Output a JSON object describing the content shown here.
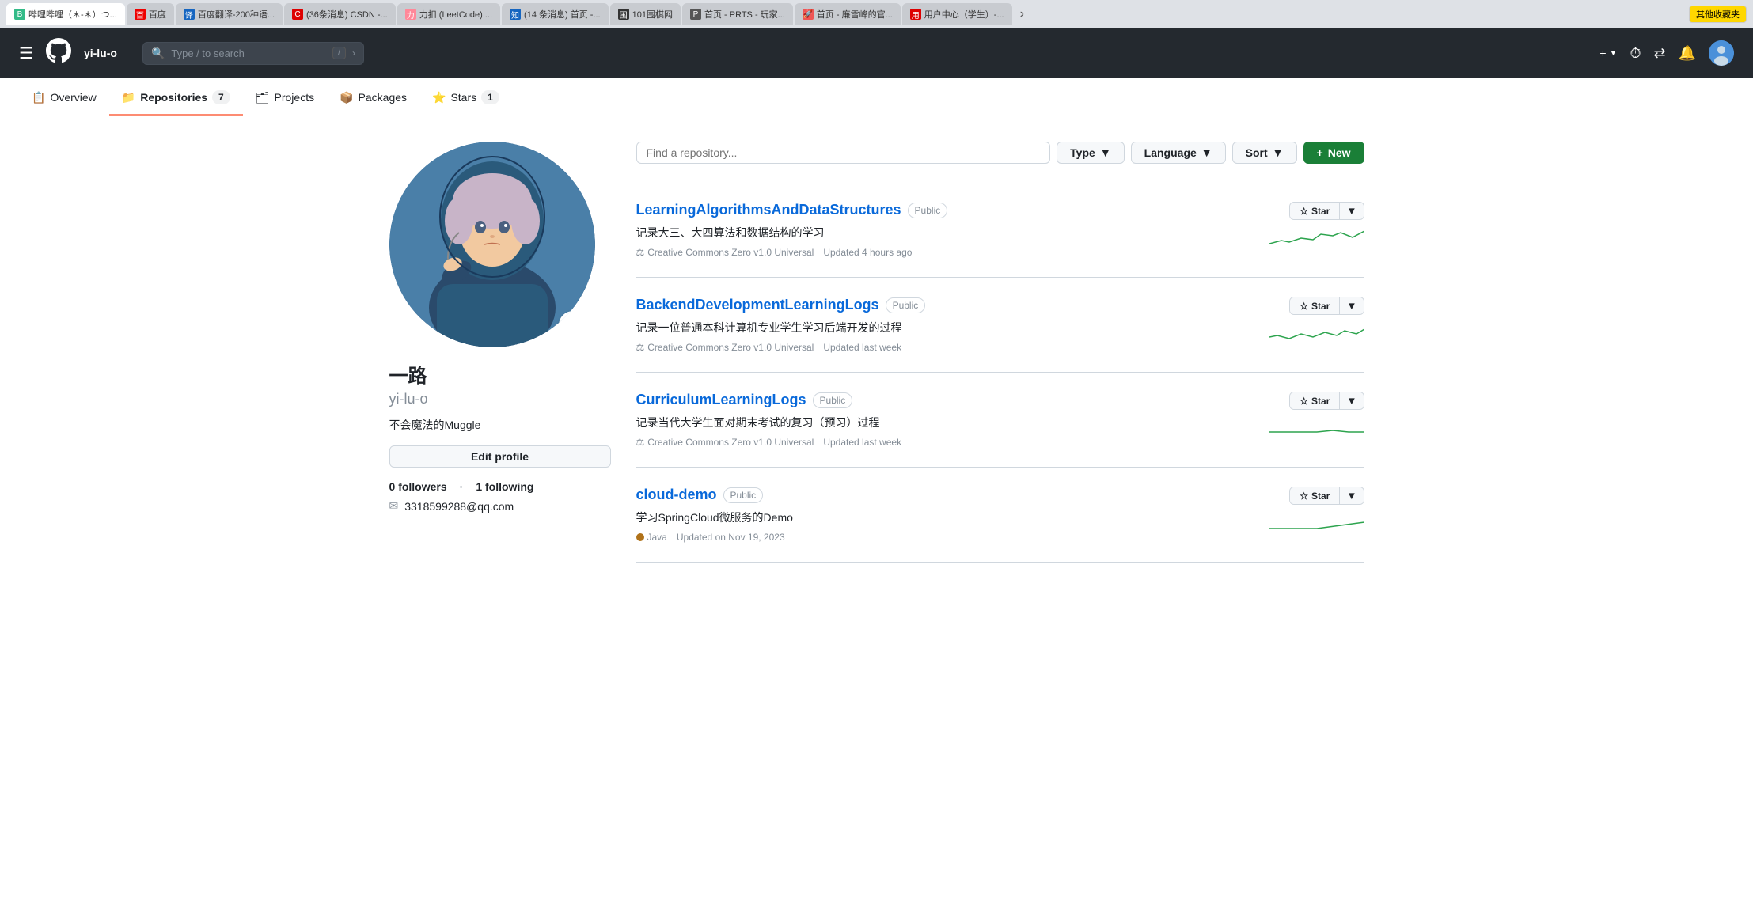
{
  "browser": {
    "tabs": [
      {
        "id": "baidu",
        "label": "百度",
        "favicon_color": "#e00",
        "active": false
      },
      {
        "id": "baidu-translate",
        "label": "百度翻译-200种语...",
        "favicon_color": "#1565c0",
        "active": false
      },
      {
        "id": "csdn",
        "label": "(36条消息) CSDN -...",
        "favicon_color": "#d00",
        "active": false
      },
      {
        "id": "leetcode",
        "label": "力扣 (LeetCode) ...",
        "favicon_color": "#f89",
        "active": false
      },
      {
        "id": "zhihu",
        "label": "(14 条消息) 首页 -...",
        "favicon_color": "#1565c0",
        "active": false
      },
      {
        "id": "bilibili",
        "label": "哔哩哔哩（*-*）つ...",
        "favicon_color": "#3b8",
        "active": true
      },
      {
        "id": "chess101",
        "label": "101围棋网",
        "favicon_color": "#333",
        "active": false
      },
      {
        "id": "prts",
        "label": "首页 - PRTS - 玩家...",
        "favicon_color": "#555",
        "active": false
      },
      {
        "id": "rocket",
        "label": "首页 - 廉雪峰的官...",
        "favicon_color": "#e55",
        "active": false
      },
      {
        "id": "user-center",
        "label": "用户中心（学生）-...",
        "favicon_color": "#d00",
        "active": false
      }
    ],
    "more_tabs_label": "...",
    "bookmarks_label": "其他收藏夹"
  },
  "navbar": {
    "hamburger_label": "☰",
    "logo_label": "⬛",
    "username": "yi-lu-o",
    "search_placeholder": "Type / to search",
    "search_kbd": "/",
    "new_label": "New",
    "plus_label": "+"
  },
  "profile_nav": {
    "tabs": [
      {
        "id": "overview",
        "label": "Overview",
        "count": null,
        "active": false,
        "icon": "📋"
      },
      {
        "id": "repositories",
        "label": "Repositories",
        "count": "7",
        "active": true,
        "icon": "📁"
      },
      {
        "id": "projects",
        "label": "Projects",
        "count": null,
        "active": false,
        "icon": "🗂"
      },
      {
        "id": "packages",
        "label": "Packages",
        "count": null,
        "active": false,
        "icon": "📦"
      },
      {
        "id": "stars",
        "label": "Stars",
        "count": "1",
        "active": false,
        "icon": "⭐"
      }
    ]
  },
  "sidebar": {
    "display_name": "一路",
    "username": "yi-lu-o",
    "bio": "不会魔法的Muggle",
    "edit_profile_label": "Edit profile",
    "followers_count": "0",
    "followers_label": "followers",
    "following_count": "1",
    "following_label": "following",
    "email": "3318599288@qq.com"
  },
  "toolbar": {
    "find_placeholder": "Find a repository...",
    "type_label": "Type",
    "language_label": "Language",
    "sort_label": "Sort",
    "new_label": "New",
    "new_icon": "+"
  },
  "repos": [
    {
      "id": "repo1",
      "name": "LearningAlgorithmsAndDataStructures",
      "visibility": "Public",
      "description": "记录大三、大四算法和数据结构的学习",
      "license": "Creative Commons Zero v1.0 Universal",
      "updated": "Updated 4 hours ago",
      "language": null,
      "lang_color": null,
      "star_label": "Star",
      "sparkline_color": "#2da44e"
    },
    {
      "id": "repo2",
      "name": "BackendDevelopmentLearningLogs",
      "visibility": "Public",
      "description": "记录一位普通本科计算机专业学生学习后端开发的过程",
      "license": "Creative Commons Zero v1.0 Universal",
      "updated": "Updated last week",
      "language": null,
      "lang_color": null,
      "star_label": "Star",
      "sparkline_color": "#2da44e"
    },
    {
      "id": "repo3",
      "name": "CurriculumLearningLogs",
      "visibility": "Public",
      "description": "记录当代大学生面对期末考试的复习（预习）过程",
      "license": "Creative Commons Zero v1.0 Universal",
      "updated": "Updated last week",
      "language": null,
      "lang_color": null,
      "star_label": "Star",
      "sparkline_color": "#2da44e"
    },
    {
      "id": "repo4",
      "name": "cloud-demo",
      "visibility": "Public",
      "description": "学习SpringCloud微服务的Demo",
      "license": null,
      "updated": "Updated on Nov 19, 2023",
      "language": "Java",
      "lang_color": "#b07219",
      "star_label": "Star",
      "sparkline_color": "#2da44e"
    }
  ]
}
